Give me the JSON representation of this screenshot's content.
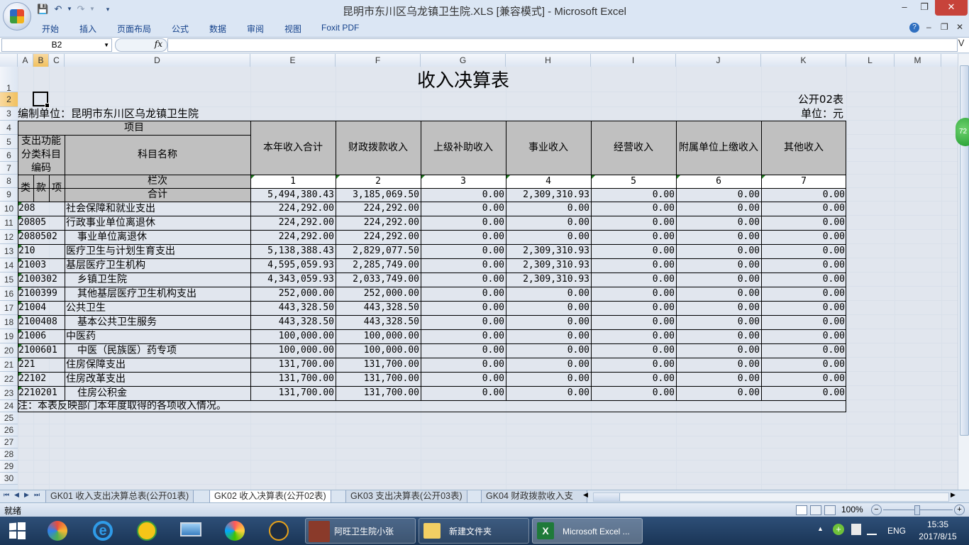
{
  "window": {
    "title": "昆明市东川区乌龙镇卫生院.XLS  [兼容模式] - Microsoft Excel"
  },
  "ribbon": {
    "tabs": [
      "开始",
      "插入",
      "页面布局",
      "公式",
      "数据",
      "审阅",
      "视图",
      "Foxit PDF"
    ]
  },
  "formula_bar": {
    "name_box": "B2",
    "fx_label": "fx",
    "formula": ""
  },
  "columns": [
    "A",
    "B",
    "C",
    "D",
    "E",
    "F",
    "G",
    "H",
    "I",
    "J",
    "K",
    "L",
    "M"
  ],
  "rows": [
    "1",
    "2",
    "3",
    "4",
    "5",
    "6",
    "7",
    "8",
    "9",
    "10",
    "11",
    "12",
    "13",
    "14",
    "15",
    "16",
    "17",
    "18",
    "19",
    "20",
    "21",
    "22",
    "23",
    "24",
    "25",
    "26",
    "27",
    "28",
    "29",
    "30"
  ],
  "sheet": {
    "title": "收入决算表",
    "form_code": "公开02表",
    "unit_label": "编制单位：昆明市东川区乌龙镇卫生院",
    "unit_measure": "单位：元",
    "header": {
      "project": "项目",
      "code_group": "支出功能分类科目编码",
      "subject_name": "科目名称",
      "lanci": "栏次",
      "lei": "类",
      "kuan": "款",
      "xiang": "项",
      "heji": "合计",
      "cols": [
        "本年收入合计",
        "财政拨款收入",
        "上级补助收入",
        "事业收入",
        "经营收入",
        "附属单位上缴收入",
        "其他收入"
      ],
      "col_nums": [
        "1",
        "2",
        "3",
        "4",
        "5",
        "6",
        "7"
      ]
    },
    "total_row": [
      "5,494,380.43",
      "3,185,069.50",
      "0.00",
      "2,309,310.93",
      "0.00",
      "0.00",
      "0.00"
    ],
    "data_rows": [
      {
        "code": "208",
        "name": "社会保障和就业支出",
        "v": [
          "224,292.00",
          "224,292.00",
          "0.00",
          "0.00",
          "0.00",
          "0.00",
          "0.00"
        ]
      },
      {
        "code": "20805",
        "name": "行政事业单位离退休",
        "v": [
          "224,292.00",
          "224,292.00",
          "0.00",
          "0.00",
          "0.00",
          "0.00",
          "0.00"
        ]
      },
      {
        "code": "2080502",
        "name": "  事业单位离退休",
        "v": [
          "224,292.00",
          "224,292.00",
          "0.00",
          "0.00",
          "0.00",
          "0.00",
          "0.00"
        ]
      },
      {
        "code": "210",
        "name": "医疗卫生与计划生育支出",
        "v": [
          "5,138,388.43",
          "2,829,077.50",
          "0.00",
          "2,309,310.93",
          "0.00",
          "0.00",
          "0.00"
        ]
      },
      {
        "code": "21003",
        "name": "基层医疗卫生机构",
        "v": [
          "4,595,059.93",
          "2,285,749.00",
          "0.00",
          "2,309,310.93",
          "0.00",
          "0.00",
          "0.00"
        ]
      },
      {
        "code": "2100302",
        "name": "  乡镇卫生院",
        "v": [
          "4,343,059.93",
          "2,033,749.00",
          "0.00",
          "2,309,310.93",
          "0.00",
          "0.00",
          "0.00"
        ]
      },
      {
        "code": "2100399",
        "name": "  其他基层医疗卫生机构支出",
        "v": [
          "252,000.00",
          "252,000.00",
          "0.00",
          "0.00",
          "0.00",
          "0.00",
          "0.00"
        ]
      },
      {
        "code": "21004",
        "name": "公共卫生",
        "v": [
          "443,328.50",
          "443,328.50",
          "0.00",
          "0.00",
          "0.00",
          "0.00",
          "0.00"
        ]
      },
      {
        "code": "2100408",
        "name": "  基本公共卫生服务",
        "v": [
          "443,328.50",
          "443,328.50",
          "0.00",
          "0.00",
          "0.00",
          "0.00",
          "0.00"
        ]
      },
      {
        "code": "21006",
        "name": "中医药",
        "v": [
          "100,000.00",
          "100,000.00",
          "0.00",
          "0.00",
          "0.00",
          "0.00",
          "0.00"
        ]
      },
      {
        "code": "2100601",
        "name": "  中医（民族医）药专项",
        "v": [
          "100,000.00",
          "100,000.00",
          "0.00",
          "0.00",
          "0.00",
          "0.00",
          "0.00"
        ]
      },
      {
        "code": "221",
        "name": "住房保障支出",
        "v": [
          "131,700.00",
          "131,700.00",
          "0.00",
          "0.00",
          "0.00",
          "0.00",
          "0.00"
        ]
      },
      {
        "code": "22102",
        "name": "住房改革支出",
        "v": [
          "131,700.00",
          "131,700.00",
          "0.00",
          "0.00",
          "0.00",
          "0.00",
          "0.00"
        ]
      },
      {
        "code": "2210201",
        "name": "  住房公积金",
        "v": [
          "131,700.00",
          "131,700.00",
          "0.00",
          "0.00",
          "0.00",
          "0.00",
          "0.00"
        ]
      }
    ],
    "note": "注：本表反映部门本年度取得的各项收入情况。"
  },
  "sheet_tabs": [
    "GK01 收入支出决算总表(公开01表)",
    "GK02 收入决算表(公开02表)",
    "GK03 支出决算表(公开03表)",
    "GK04 财政拨款收入支"
  ],
  "status": {
    "ready": "就绪",
    "zoom": "100%"
  },
  "taskbar": {
    "tasks": [
      "阿旺卫生院小张",
      "新建文件夹",
      "Microsoft Excel ..."
    ],
    "lang": "ENG",
    "time": "15:35",
    "date": "2017/8/15"
  },
  "side_badge": "72"
}
